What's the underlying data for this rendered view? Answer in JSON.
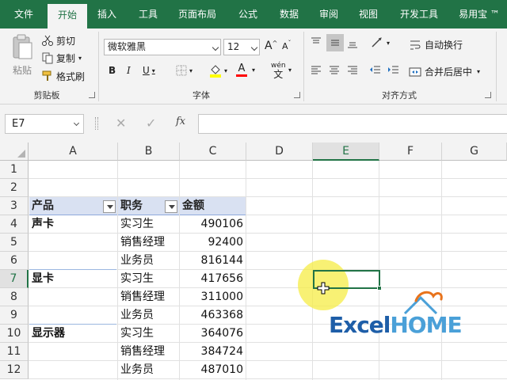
{
  "menu": {
    "items": [
      "文件",
      "开始",
      "插入",
      "工具",
      "页面布局",
      "公式",
      "数据",
      "审阅",
      "视图",
      "开发工具",
      "易用宝 ™"
    ],
    "active_index": 1
  },
  "ribbon": {
    "clipboard": {
      "label": "剪贴板",
      "paste": "粘贴",
      "cut": "剪切",
      "copy": "复制",
      "format_painter": "格式刷"
    },
    "font": {
      "label": "字体",
      "name": "微软雅黑",
      "size": "12",
      "bold": "B",
      "italic": "I",
      "underline": "U",
      "grow": "A",
      "shrink": "A",
      "font_color_glyph": "A",
      "phonetic": "wén"
    },
    "alignment": {
      "label": "对齐方式",
      "wrap": "自动换行",
      "merge": "合并后居中"
    }
  },
  "formula_bar": {
    "name_box": "E7",
    "fx": "fx",
    "formula": ""
  },
  "sheet": {
    "columns": [
      "A",
      "B",
      "C",
      "D",
      "E",
      "F",
      "G"
    ],
    "rows": [
      "1",
      "2",
      "3",
      "4",
      "5",
      "6",
      "7",
      "8",
      "9",
      "10",
      "11",
      "12"
    ],
    "selected_column": "E",
    "selected_row": "7",
    "header_row": {
      "product": "产品",
      "role": "职务",
      "amount": "金额"
    },
    "data": [
      {
        "product": "声卡",
        "role": "实习生",
        "amount": "490106"
      },
      {
        "product": "",
        "role": "销售经理",
        "amount": "92400"
      },
      {
        "product": "",
        "role": "业务员",
        "amount": "816144"
      },
      {
        "product": "显卡",
        "role": "实习生",
        "amount": "417656"
      },
      {
        "product": "",
        "role": "销售经理",
        "amount": "311000"
      },
      {
        "product": "",
        "role": "业务员",
        "amount": "463368"
      },
      {
        "product": "显示器",
        "role": "实习生",
        "amount": "364076"
      },
      {
        "product": "",
        "role": "销售经理",
        "amount": "384724"
      },
      {
        "product": "",
        "role": "业务员",
        "amount": "487010"
      }
    ]
  },
  "watermark": {
    "excel": "Excel",
    "home": "HOME"
  },
  "colors": {
    "accent": "#217346",
    "pivot_header": "#d9e1f2",
    "logo_blue": "#1e5ea8",
    "logo_light": "#4aa0d8",
    "logo_orange": "#e8731c"
  }
}
